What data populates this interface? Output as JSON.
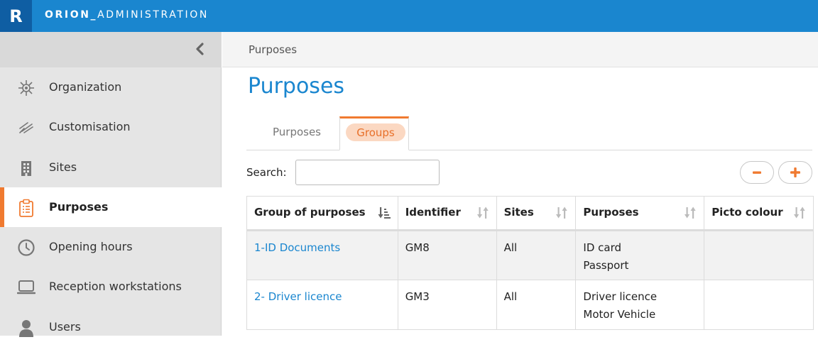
{
  "app": {
    "logo_letter": "R",
    "name_bold": "ORION_",
    "name_rest": "ADMINISTRATION"
  },
  "sidebar": {
    "items": [
      {
        "label": "Organization",
        "icon": "network-icon"
      },
      {
        "label": "Customisation",
        "icon": "brush-icon"
      },
      {
        "label": "Sites",
        "icon": "building-icon"
      },
      {
        "label": "Purposes",
        "icon": "clipboard-icon",
        "active": true
      },
      {
        "label": "Opening hours",
        "icon": "clock-icon"
      },
      {
        "label": "Reception workstations",
        "icon": "monitor-icon"
      },
      {
        "label": "Users",
        "icon": "user-icon"
      }
    ]
  },
  "breadcrumb": "Purposes",
  "page_title": "Purposes",
  "tabs": [
    {
      "label": "Purposes"
    },
    {
      "label": "Groups",
      "active": true
    }
  ],
  "search": {
    "label": "Search:",
    "value": ""
  },
  "table": {
    "headers": [
      "Group of purposes",
      "Identifier",
      "Sites",
      "Purposes",
      "Picto colour"
    ],
    "rows": [
      {
        "group": "1-ID Documents",
        "identifier": "GM8",
        "sites": "All",
        "purposes": [
          "ID card",
          "Passport"
        ],
        "picto": ""
      },
      {
        "group": "2- Driver licence",
        "identifier": "GM3",
        "sites": "All",
        "purposes": [
          "Driver licence",
          "Motor Vehicle"
        ],
        "picto": ""
      }
    ]
  },
  "colors": {
    "brand": "#1a86cf",
    "accent": "#f07a30"
  }
}
